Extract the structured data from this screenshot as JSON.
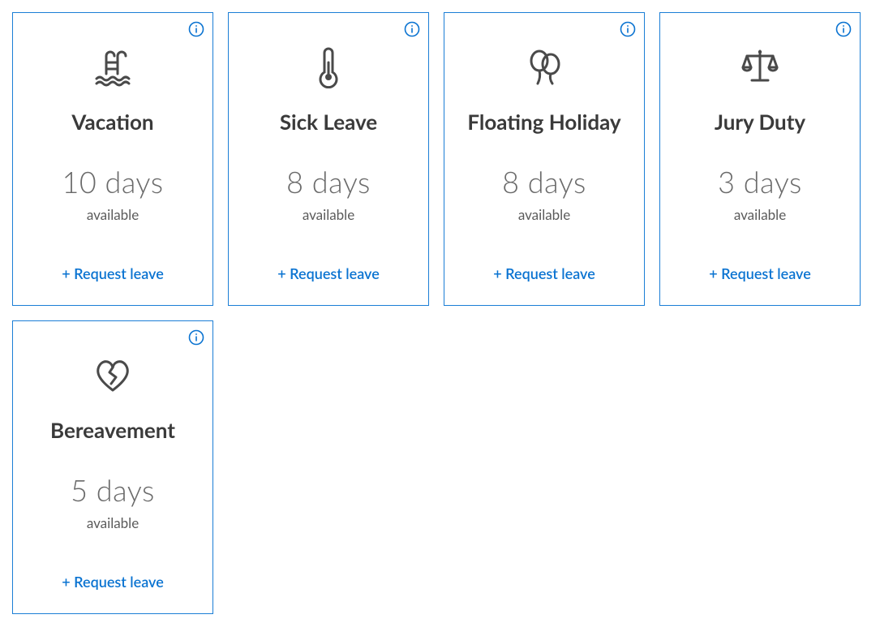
{
  "colors": {
    "border": "#1b7ed6",
    "link": "#0a73d1",
    "title": "#3a3a3a",
    "muted": "#6a6a6a"
  },
  "common": {
    "available_label": "available",
    "action_label": "+ Request leave"
  },
  "cards": [
    {
      "id": "vacation",
      "title": "Vacation",
      "amount": "10 days",
      "icon": "pool-icon"
    },
    {
      "id": "sick-leave",
      "title": "Sick Leave",
      "amount": "8 days",
      "icon": "thermometer-icon"
    },
    {
      "id": "floating-holiday",
      "title": "Floating Holiday",
      "amount": "8 days",
      "icon": "balloons-icon"
    },
    {
      "id": "jury-duty",
      "title": "Jury Duty",
      "amount": "3 days",
      "icon": "scales-icon"
    },
    {
      "id": "bereavement",
      "title": "Bereavement",
      "amount": "5 days",
      "icon": "broken-heart-icon"
    }
  ]
}
